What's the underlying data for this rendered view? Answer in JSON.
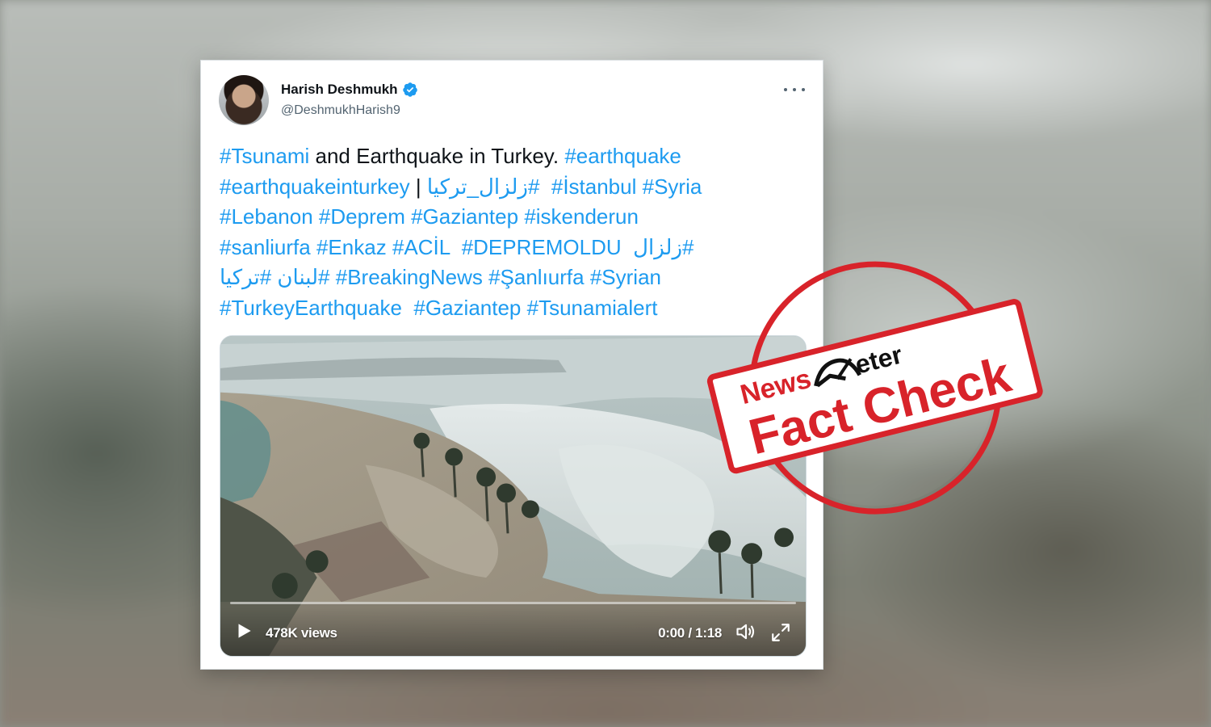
{
  "tweet": {
    "author_name": "Harish Deshmukh",
    "author_handle": "@DeshmukhHarish9",
    "lines": [
      [
        {
          "text": "#Tsunami",
          "tag": true
        },
        {
          "text": " and Earthquake in Turkey. ",
          "tag": false
        },
        {
          "text": "#earthquake",
          "tag": true
        }
      ],
      [
        {
          "text": "#earthquakeinturkey",
          "tag": true
        },
        {
          "text": " | ",
          "tag": false
        },
        {
          "text": "#زلزال_تركيا",
          "tag": true,
          "rtl": true
        },
        {
          "text": "  ",
          "tag": false
        },
        {
          "text": "#İstanbul",
          "tag": true
        },
        {
          "text": " ",
          "tag": false
        },
        {
          "text": "#Syria",
          "tag": true
        }
      ],
      [
        {
          "text": "#Lebanon",
          "tag": true
        },
        {
          "text": " ",
          "tag": false
        },
        {
          "text": "#Deprem",
          "tag": true
        },
        {
          "text": " ",
          "tag": false
        },
        {
          "text": "#Gaziantep",
          "tag": true
        },
        {
          "text": " ",
          "tag": false
        },
        {
          "text": "#iskenderun",
          "tag": true
        }
      ],
      [
        {
          "text": "#sanliurfa",
          "tag": true
        },
        {
          "text": " ",
          "tag": false
        },
        {
          "text": "#Enkaz",
          "tag": true
        },
        {
          "text": " ",
          "tag": false
        },
        {
          "text": "#ACİL",
          "tag": true
        },
        {
          "text": "  ",
          "tag": false
        },
        {
          "text": "#DEPREMOLDU",
          "tag": true
        },
        {
          "text": "  ",
          "tag": false
        },
        {
          "text": "#زلزال",
          "tag": true,
          "rtl": true
        }
      ],
      [
        {
          "text": "#تركيا",
          "tag": true,
          "rtl": true
        },
        {
          "text": " ",
          "tag": false
        },
        {
          "text": "#لبنان",
          "tag": true,
          "rtl": true
        },
        {
          "text": " ",
          "tag": false
        },
        {
          "text": "#BreakingNews",
          "tag": true
        },
        {
          "text": " ",
          "tag": false
        },
        {
          "text": "#Şanlıurfa",
          "tag": true
        },
        {
          "text": " ",
          "tag": false
        },
        {
          "text": "#Syrian",
          "tag": true
        }
      ],
      [
        {
          "text": "#TurkeyEarthquake",
          "tag": true
        },
        {
          "text": "  ",
          "tag": false
        },
        {
          "text": "#Gaziantep",
          "tag": true
        },
        {
          "text": " ",
          "tag": false
        },
        {
          "text": "#Tsunamialert",
          "tag": true
        }
      ]
    ]
  },
  "video": {
    "views": "478K views",
    "time": "0:00 / 1:18",
    "progress": 0
  },
  "stamp": {
    "brand_news": "News",
    "brand_meter": "eter",
    "label": "Fact Check"
  },
  "colors": {
    "link": "#1d9bf0",
    "text": "#0f1419",
    "muted": "#536471",
    "stamp_red": "#d8232a"
  },
  "icons": [
    "verified-badge-icon",
    "more-options-icon",
    "play-icon",
    "volume-icon",
    "fullscreen-icon",
    "meter-gauge-icon"
  ]
}
